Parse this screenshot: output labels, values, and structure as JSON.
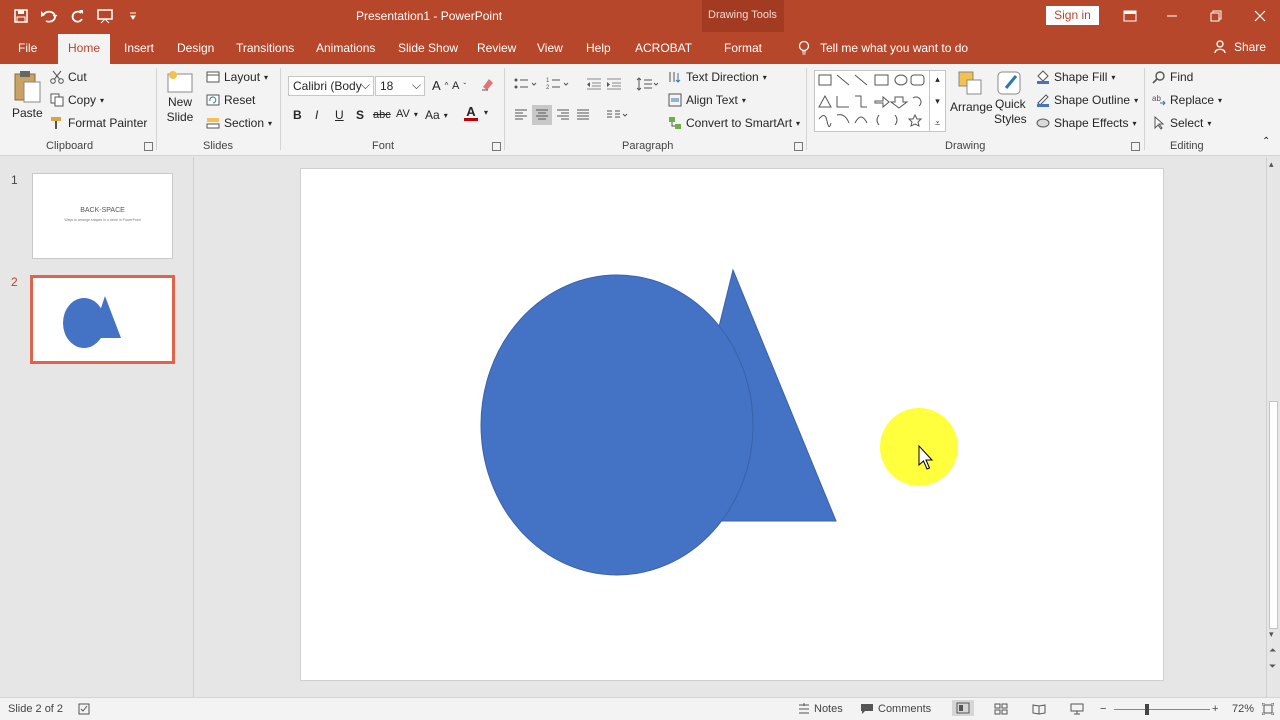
{
  "window": {
    "title": "Presentation1  -  PowerPoint",
    "context_tab_header": "Drawing Tools",
    "sign_in": "Sign in"
  },
  "tabs": [
    {
      "label": "File"
    },
    {
      "label": "Home"
    },
    {
      "label": "Insert"
    },
    {
      "label": "Design"
    },
    {
      "label": "Transitions"
    },
    {
      "label": "Animations"
    },
    {
      "label": "Slide Show"
    },
    {
      "label": "Review"
    },
    {
      "label": "View"
    },
    {
      "label": "Help"
    },
    {
      "label": "ACROBAT"
    },
    {
      "label": "Format"
    }
  ],
  "tell_me": "Tell me what you want to do",
  "share": "Share",
  "ribbon": {
    "clipboard": {
      "label": "Clipboard",
      "paste": "Paste",
      "cut": "Cut",
      "copy": "Copy",
      "format_painter": "Format Painter"
    },
    "slides": {
      "label": "Slides",
      "new_slide_1": "New",
      "new_slide_2": "Slide",
      "layout": "Layout",
      "reset": "Reset",
      "section": "Section"
    },
    "font": {
      "label": "Font",
      "font_name": "Calibri (Body",
      "font_size": "18",
      "bold": "B",
      "italic": "I",
      "underline": "U",
      "shadow": "S",
      "strike": "abc",
      "spacing": "AV",
      "case": "Aa",
      "color_a": "A"
    },
    "paragraph": {
      "label": "Paragraph",
      "text_direction": "Text Direction",
      "align_text": "Align Text",
      "convert_smartart": "Convert to SmartArt"
    },
    "drawing": {
      "label": "Drawing",
      "arrange": "Arrange",
      "quick_styles_1": "Quick",
      "quick_styles_2": "Styles",
      "shape_fill": "Shape Fill",
      "shape_outline": "Shape Outline",
      "shape_effects": "Shape Effects"
    },
    "editing": {
      "label": "Editing",
      "find": "Find",
      "replace": "Replace",
      "select": "Select"
    }
  },
  "thumbnails": [
    {
      "number": "1",
      "title": "BACK-SPACE",
      "subtitle": "Ways to arrange shapes in a circle in PowerPoint"
    },
    {
      "number": "2"
    }
  ],
  "status": {
    "slide_indicator": "Slide 2 of 2",
    "notes": "Notes",
    "comments": "Comments",
    "zoom": "72%"
  },
  "colors": {
    "accent": "#b7472a",
    "shape_fill": "#4472c4",
    "highlight": "#ffff33",
    "selection_border": "#e0634b"
  }
}
